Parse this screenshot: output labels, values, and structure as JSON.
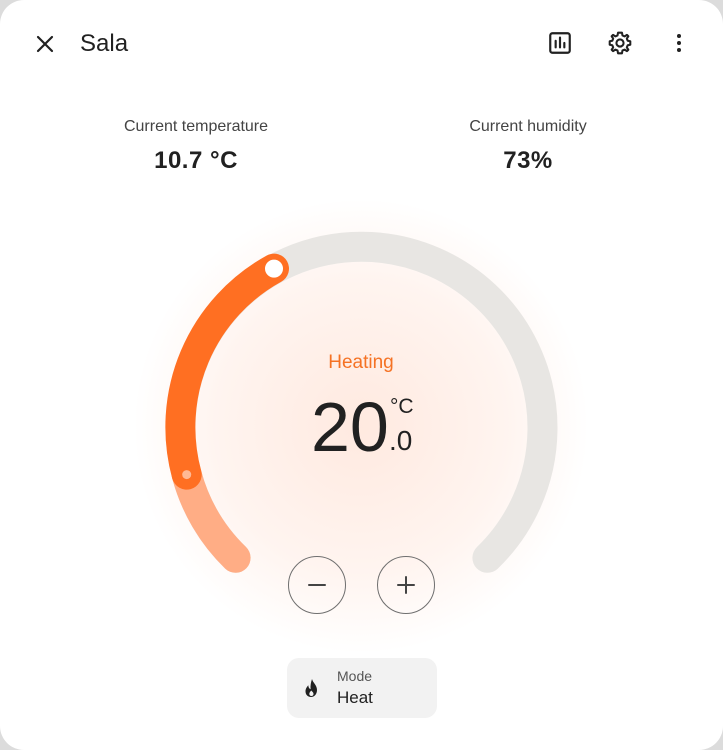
{
  "dialog": {
    "title": "Sala",
    "icons": {
      "close": "close-icon",
      "history": "chart-bar-icon",
      "settings": "gear-icon",
      "menu": "dots-vertical-icon"
    }
  },
  "attributes": [
    {
      "label": "Current temperature",
      "value": "10.7 °C"
    },
    {
      "label": "Current humidity",
      "value": "73%"
    }
  ],
  "thermostat": {
    "state": "Heating",
    "target_integer": "20",
    "target_decimal": ".0",
    "unit": "°C",
    "colors": {
      "accent": "#ff6f22",
      "accent_light": "#ffad85",
      "track": "#e8e6e3",
      "state_text": "#f57224"
    }
  },
  "controls": {
    "decrease_symbol": "−",
    "increase_symbol": "+"
  },
  "mode": {
    "label": "Mode",
    "value": "Heat",
    "icon": "fire-icon"
  }
}
